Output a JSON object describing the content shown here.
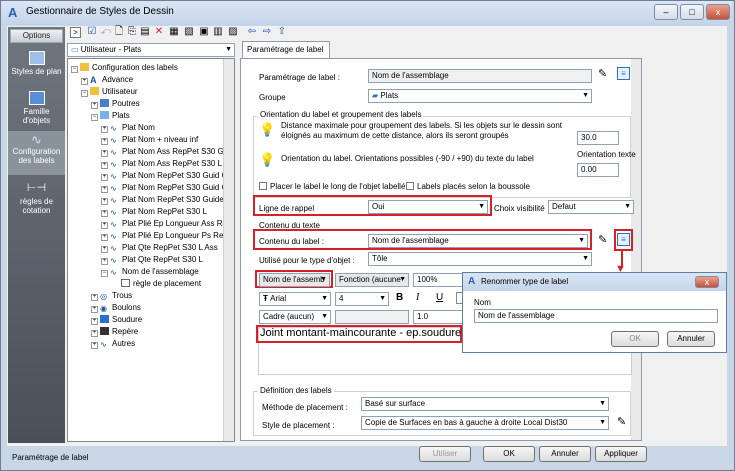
{
  "window": {
    "title": "Gestionnaire de Styles de Dessin",
    "min": "–",
    "max": "□",
    "close": "x"
  },
  "leftbar": {
    "options": "Options",
    "items": [
      {
        "label1": "Styles de plan",
        "label2": ""
      },
      {
        "label1": "Famille",
        "label2": "d'objets"
      },
      {
        "label1": "Configuration",
        "label2": "des labels"
      },
      {
        "label1": "règles de",
        "label2": "cotation"
      }
    ]
  },
  "toolbar": {
    "combo": "Utilisateur - Plats"
  },
  "tree": {
    "nodes": [
      "Configuration des labels",
      "Advance",
      "Utilisateur",
      "Poutres",
      "Plats",
      "Plat Nom",
      "Plat Nom + niveau inf",
      "Plat Nom Ass RepPet S30 Gu",
      "Plat Nom Ass RepPet S30 L",
      "Plat Nom RepPet S30 Guid G",
      "Plat Nom RepPet S30 Guid G",
      "Plat Nom RepPet S30 Guide",
      "Plat Nom RepPet S30 L",
      "Plat Plié Ep Longueur Ass Re",
      "Plat Plié Ep Longueur Ps Rep",
      "Plat Qte RepPet S30 L Ass",
      "Plat Qte RepPet S30 L",
      "Nom de l'assemblage",
      "règle de placement",
      "Trous",
      "Boulons",
      "Soudure",
      "Repère",
      "Autres"
    ]
  },
  "panel": {
    "tab": "Paramétrage de label",
    "param_label": "Paramétrage de label :",
    "param_value": "Nom de l'assemblage",
    "groupe_label": "Groupe",
    "groupe_value": "Plats",
    "orient_section": "Orientation du label et groupement des labels",
    "dist_text1": "Distance maximale pour groupement des labels. Si les objets sur le dessin sont",
    "dist_text2": "éloignés au maximum de cette distance, alors ils seront groupés",
    "dist_value": "30.0",
    "orient_label": "Orientation texte",
    "orient_text": "Orientation du label. Orientations possibles (-90 / +90) du texte du label",
    "orient_value": "0.00",
    "chk1": "Placer le label le long de l'objet labellé",
    "chk2": "Labels placés selon la boussole",
    "rappel_label": "Ligne de rappel",
    "rappel_value": "Oui",
    "visib_label": "Choix visibilité",
    "visib_value": "Defaut",
    "contenu_section": "Contenu du texte",
    "contenu_label": "Contenu du label :",
    "contenu_value": "Nom de l'assemblage",
    "type_label": "Utilisé pour le type d'objet :",
    "type_value": "Tôle",
    "field_combo": "Nom de l'assemb",
    "func_combo": "Fonction (aucune",
    "pct": "100%",
    "font": "Arial",
    "size": "4",
    "bold": "B",
    "italic": "I",
    "underline": "U",
    "cadre": "Cadre (aucun)",
    "cadre_val": "1.0",
    "sample_text": "Joint montant-maincourante - ep.soudure 1",
    "def_section": "Définition des labels",
    "methode_label": "Méthode de placement :",
    "methode_value": "Basé sur surface",
    "style_label": "Style de placement :",
    "style_value": "Copie de Surfaces en bas à gauche à droite Local Dist30"
  },
  "dialog": {
    "title": "Renommer type de label",
    "nom_label": "Nom",
    "nom_value": "Nom de l'assemblage",
    "ok": "OK",
    "cancel": "Annuler"
  },
  "footer": {
    "status": "Paramétrage de label",
    "utiliser": "Utiliser",
    "ok": "OK",
    "annuler": "Annuler",
    "appliquer": "Appliquer"
  }
}
